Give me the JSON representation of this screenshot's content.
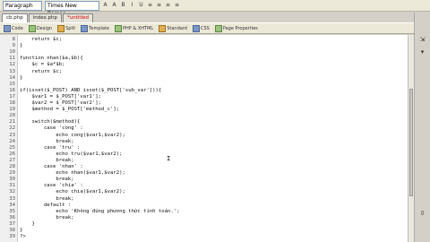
{
  "toolbar": {
    "format_select": "Paragraph",
    "font_select": "Times New Roman",
    "buttons": [
      "A",
      "A",
      "B",
      "I",
      "U",
      "≡",
      "≡",
      "≡",
      "≡"
    ]
  },
  "tabs": [
    {
      "label": "cb.php",
      "active": true
    },
    {
      "label": "index.php",
      "active": false
    },
    {
      "label": "*untitled",
      "active": false
    }
  ],
  "secondary_toolbar": {
    "items": [
      "Code",
      "Design",
      "Split",
      "Template",
      "PHP & XHTML",
      "Standard",
      "CSS",
      "Page Properties"
    ]
  },
  "editor": {
    "lines": [
      {
        "n": "8",
        "text": "    return $c;"
      },
      {
        "n": "9",
        "text": "}"
      },
      {
        "n": "10",
        "text": ""
      },
      {
        "n": "11",
        "text": "function nhan($a,$b){"
      },
      {
        "n": "12",
        "text": "    $c = $a*$b;"
      },
      {
        "n": "13",
        "text": "    return $c;"
      },
      {
        "n": "14",
        "text": "}"
      },
      {
        "n": "15",
        "text": ""
      },
      {
        "n": "16",
        "text": "if(isset($_POST) AND isset($_POST['sub_var'])){"
      },
      {
        "n": "17",
        "text": "    $var1 = $_POST['var1'];"
      },
      {
        "n": "18",
        "text": "    $var2 = $_POST['var2'];"
      },
      {
        "n": "19",
        "text": "    $method = $_POST['method_c'];"
      },
      {
        "n": "20",
        "text": ""
      },
      {
        "n": "21",
        "text": "    switch($method){"
      },
      {
        "n": "22",
        "text": "        case 'cong' :"
      },
      {
        "n": "23",
        "text": "            echo cong($var1,$var2);"
      },
      {
        "n": "24",
        "text": "            break;"
      },
      {
        "n": "25",
        "text": "        case 'tru' :"
      },
      {
        "n": "26",
        "text": "            echo tru($var1,$var2);"
      },
      {
        "n": "27",
        "text": "            break;"
      },
      {
        "n": "28",
        "text": "        case 'nhan' :"
      },
      {
        "n": "29",
        "text": "            echo nhan($var1,$var2);"
      },
      {
        "n": "30",
        "text": "            break;"
      },
      {
        "n": "31",
        "text": "        case 'chia' :"
      },
      {
        "n": "32",
        "text": "            echo chia($var1,$var2);"
      },
      {
        "n": "33",
        "text": "            break;"
      },
      {
        "n": "34",
        "text": "        default :"
      },
      {
        "n": "35",
        "text": "            echo 'Không đúng phương thức tính toán.';"
      },
      {
        "n": "36",
        "text": "            break;"
      },
      {
        "n": "37",
        "text": "    }"
      },
      {
        "n": "38",
        "text": "}"
      },
      {
        "n": "39",
        "text": "?>"
      }
    ]
  }
}
